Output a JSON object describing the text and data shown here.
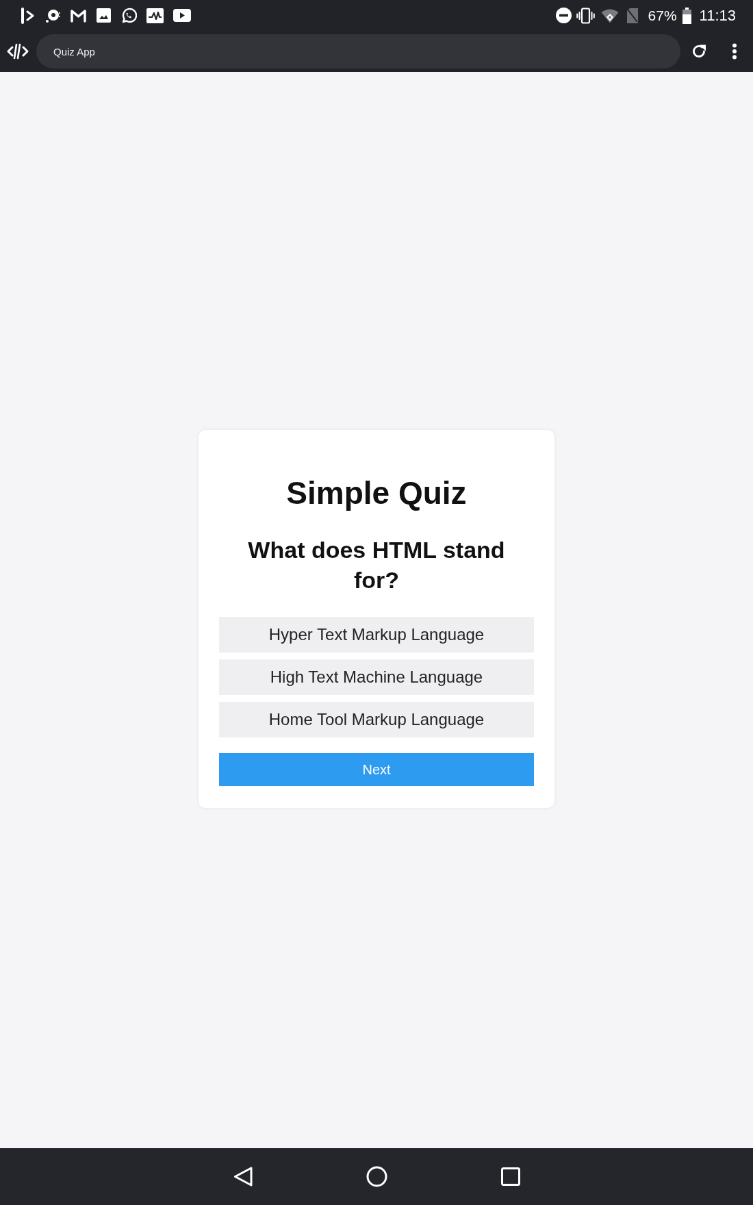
{
  "status_bar": {
    "battery": "67%",
    "time": "11:13"
  },
  "browser": {
    "page_title": "Quiz App"
  },
  "quiz": {
    "title": "Simple Quiz",
    "question": "What does HTML stand for?",
    "options": [
      {
        "label": "Hyper Text Markup Language",
        "selected": false
      },
      {
        "label": "High Text Machine Language",
        "selected": false
      },
      {
        "label": "Home Tool Markup Language",
        "selected": false
      }
    ],
    "next_button": "Next"
  }
}
